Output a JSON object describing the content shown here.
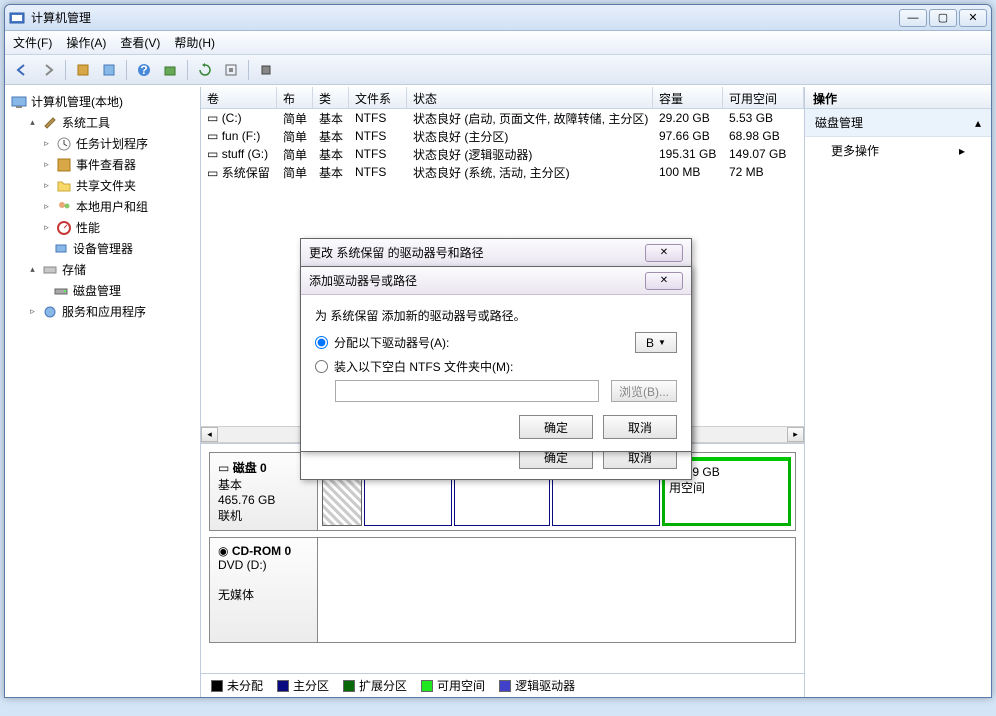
{
  "window": {
    "title": "计算机管理"
  },
  "winbtns": {
    "min": "—",
    "max": "▢",
    "close": "✕"
  },
  "menu": {
    "file": "文件(F)",
    "action": "操作(A)",
    "view": "查看(V)",
    "help": "帮助(H)"
  },
  "tree": {
    "root": "计算机管理(本地)",
    "systools": "系统工具",
    "scheduler": "任务计划程序",
    "eventviewer": "事件查看器",
    "shared": "共享文件夹",
    "users": "本地用户和组",
    "perf": "性能",
    "devmgr": "设备管理器",
    "storage": "存储",
    "diskmgmt": "磁盘管理",
    "services": "服务和应用程序"
  },
  "list": {
    "headers": {
      "volume": "卷",
      "layout": "布局",
      "type": "类型",
      "fs": "文件系统",
      "status": "状态",
      "capacity": "容量",
      "free": "可用空间"
    },
    "rows": [
      {
        "vol": "(C:)",
        "layout": "简单",
        "type": "基本",
        "fs": "NTFS",
        "status": "状态良好 (启动, 页面文件, 故障转储, 主分区)",
        "cap": "29.20 GB",
        "free": "5.53 GB"
      },
      {
        "vol": "fun (F:)",
        "layout": "简单",
        "type": "基本",
        "fs": "NTFS",
        "status": "状态良好 (主分区)",
        "cap": "97.66 GB",
        "free": "68.98 GB"
      },
      {
        "vol": "stuff (G:)",
        "layout": "简单",
        "type": "基本",
        "fs": "NTFS",
        "status": "状态良好 (逻辑驱动器)",
        "cap": "195.31 GB",
        "free": "149.07 GB"
      },
      {
        "vol": "系统保留",
        "layout": "简单",
        "type": "基本",
        "fs": "NTFS",
        "status": "状态良好 (系统, 活动, 主分区)",
        "cap": "100 MB",
        "free": "72 MB"
      }
    ]
  },
  "disks": {
    "disk0": {
      "name": "磁盘 0",
      "type": "基本",
      "size": "465.76 GB",
      "status": "联机"
    },
    "cdrom": {
      "name": "CD-ROM 0",
      "type": "DVD (D:)",
      "status": "无媒体"
    },
    "part_free": {
      "size": "43.49 GB",
      "label": "用空间"
    }
  },
  "legend": {
    "unalloc": "未分配",
    "primary": "主分区",
    "extended": "扩展分区",
    "free": "可用空间",
    "logical": "逻辑驱动器"
  },
  "sidepanel": {
    "header": "操作",
    "diskmgmt": "磁盘管理",
    "more": "更多操作"
  },
  "dialog1": {
    "title": "更改 系统保留 的驱动器号和路径",
    "ok": "确定",
    "cancel": "取消"
  },
  "dialog2": {
    "title": "添加驱动器号或路径",
    "prompt": "为 系统保留 添加新的驱动器号或路径。",
    "opt1": "分配以下驱动器号(A):",
    "opt2": "装入以下空白 NTFS 文件夹中(M):",
    "browse": "浏览(B)...",
    "drive": "B",
    "ok": "确定",
    "cancel": "取消"
  }
}
